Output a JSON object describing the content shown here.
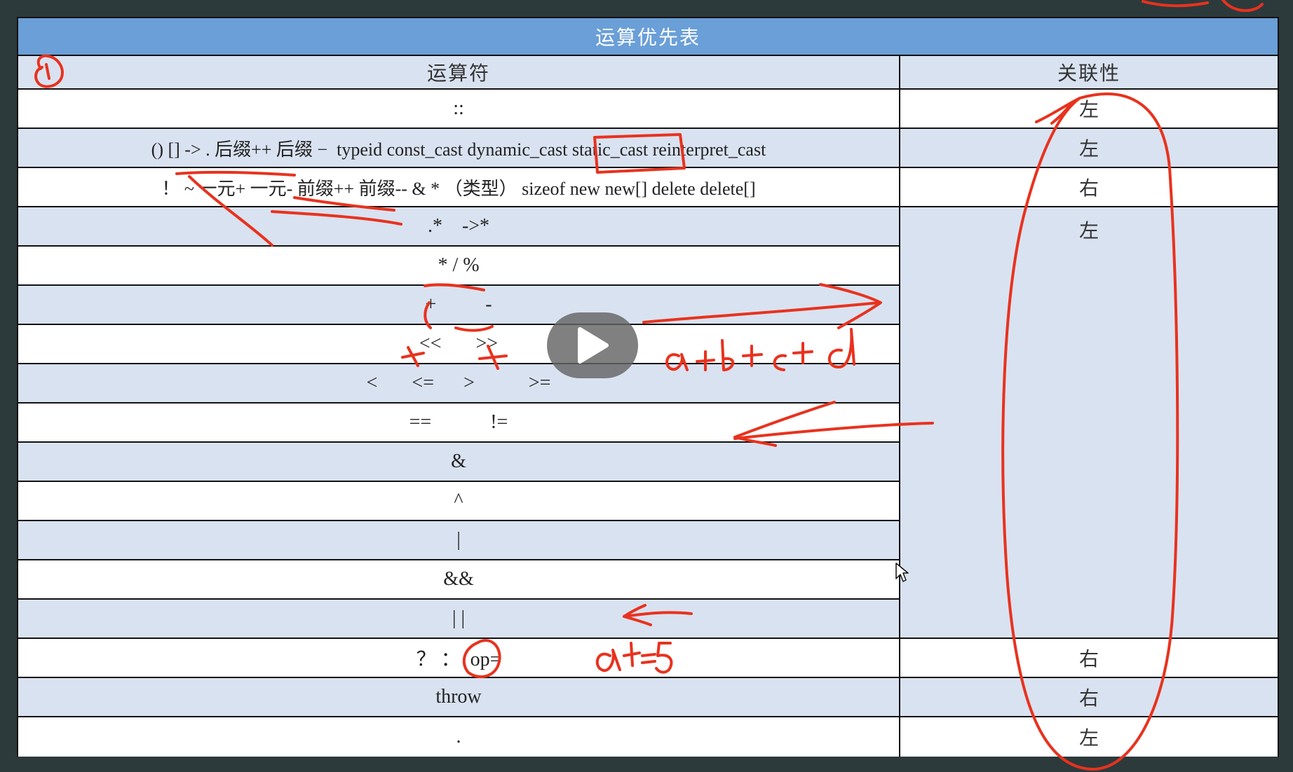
{
  "table": {
    "title": "运算优先表",
    "header": {
      "operator": "运算符",
      "associativity": "关联性"
    },
    "rows": [
      {
        "operator": "::",
        "associativity": "左"
      },
      {
        "operator": "() [] -> . 后缀++ 后缀 −  typeid const_cast dynamic_cast static_cast reinterpret_cast",
        "associativity": "左"
      },
      {
        "operator": "！ ~ 一元+ 一元- 前缀++ 前缀-- & * （类型） sizeof new new[] delete delete[]",
        "associativity": "右"
      },
      {
        "operator": ".*    ->*",
        "associativity": "左"
      },
      {
        "operator": "* / %",
        "associativity": ""
      },
      {
        "operator": "+          -",
        "associativity": ""
      },
      {
        "operator": "<<       >>",
        "associativity": ""
      },
      {
        "operator": "<       <=      >           >=",
        "associativity": ""
      },
      {
        "operator": "==            !=",
        "associativity": ""
      },
      {
        "operator": "&",
        "associativity": ""
      },
      {
        "operator": "^",
        "associativity": ""
      },
      {
        "operator": "|",
        "associativity": ""
      },
      {
        "operator": "&&",
        "associativity": ""
      },
      {
        "operator": "| |",
        "associativity": ""
      },
      {
        "operator": "？ ：  op=",
        "associativity": "右"
      },
      {
        "operator": "throw",
        "associativity": "右"
      },
      {
        "operator": ".",
        "associativity": "左"
      }
    ]
  },
  "handwriting": {
    "note_1": "a+b+c+d",
    "note_2": "a+=5",
    "circle_mark": "0"
  },
  "colors": {
    "title_bg": "#6a9fd8",
    "row_alt": "#d9e2f0",
    "ink": "#e8321e"
  },
  "icons": {
    "play": "play-icon",
    "cursor": "mouse-pointer-icon"
  }
}
